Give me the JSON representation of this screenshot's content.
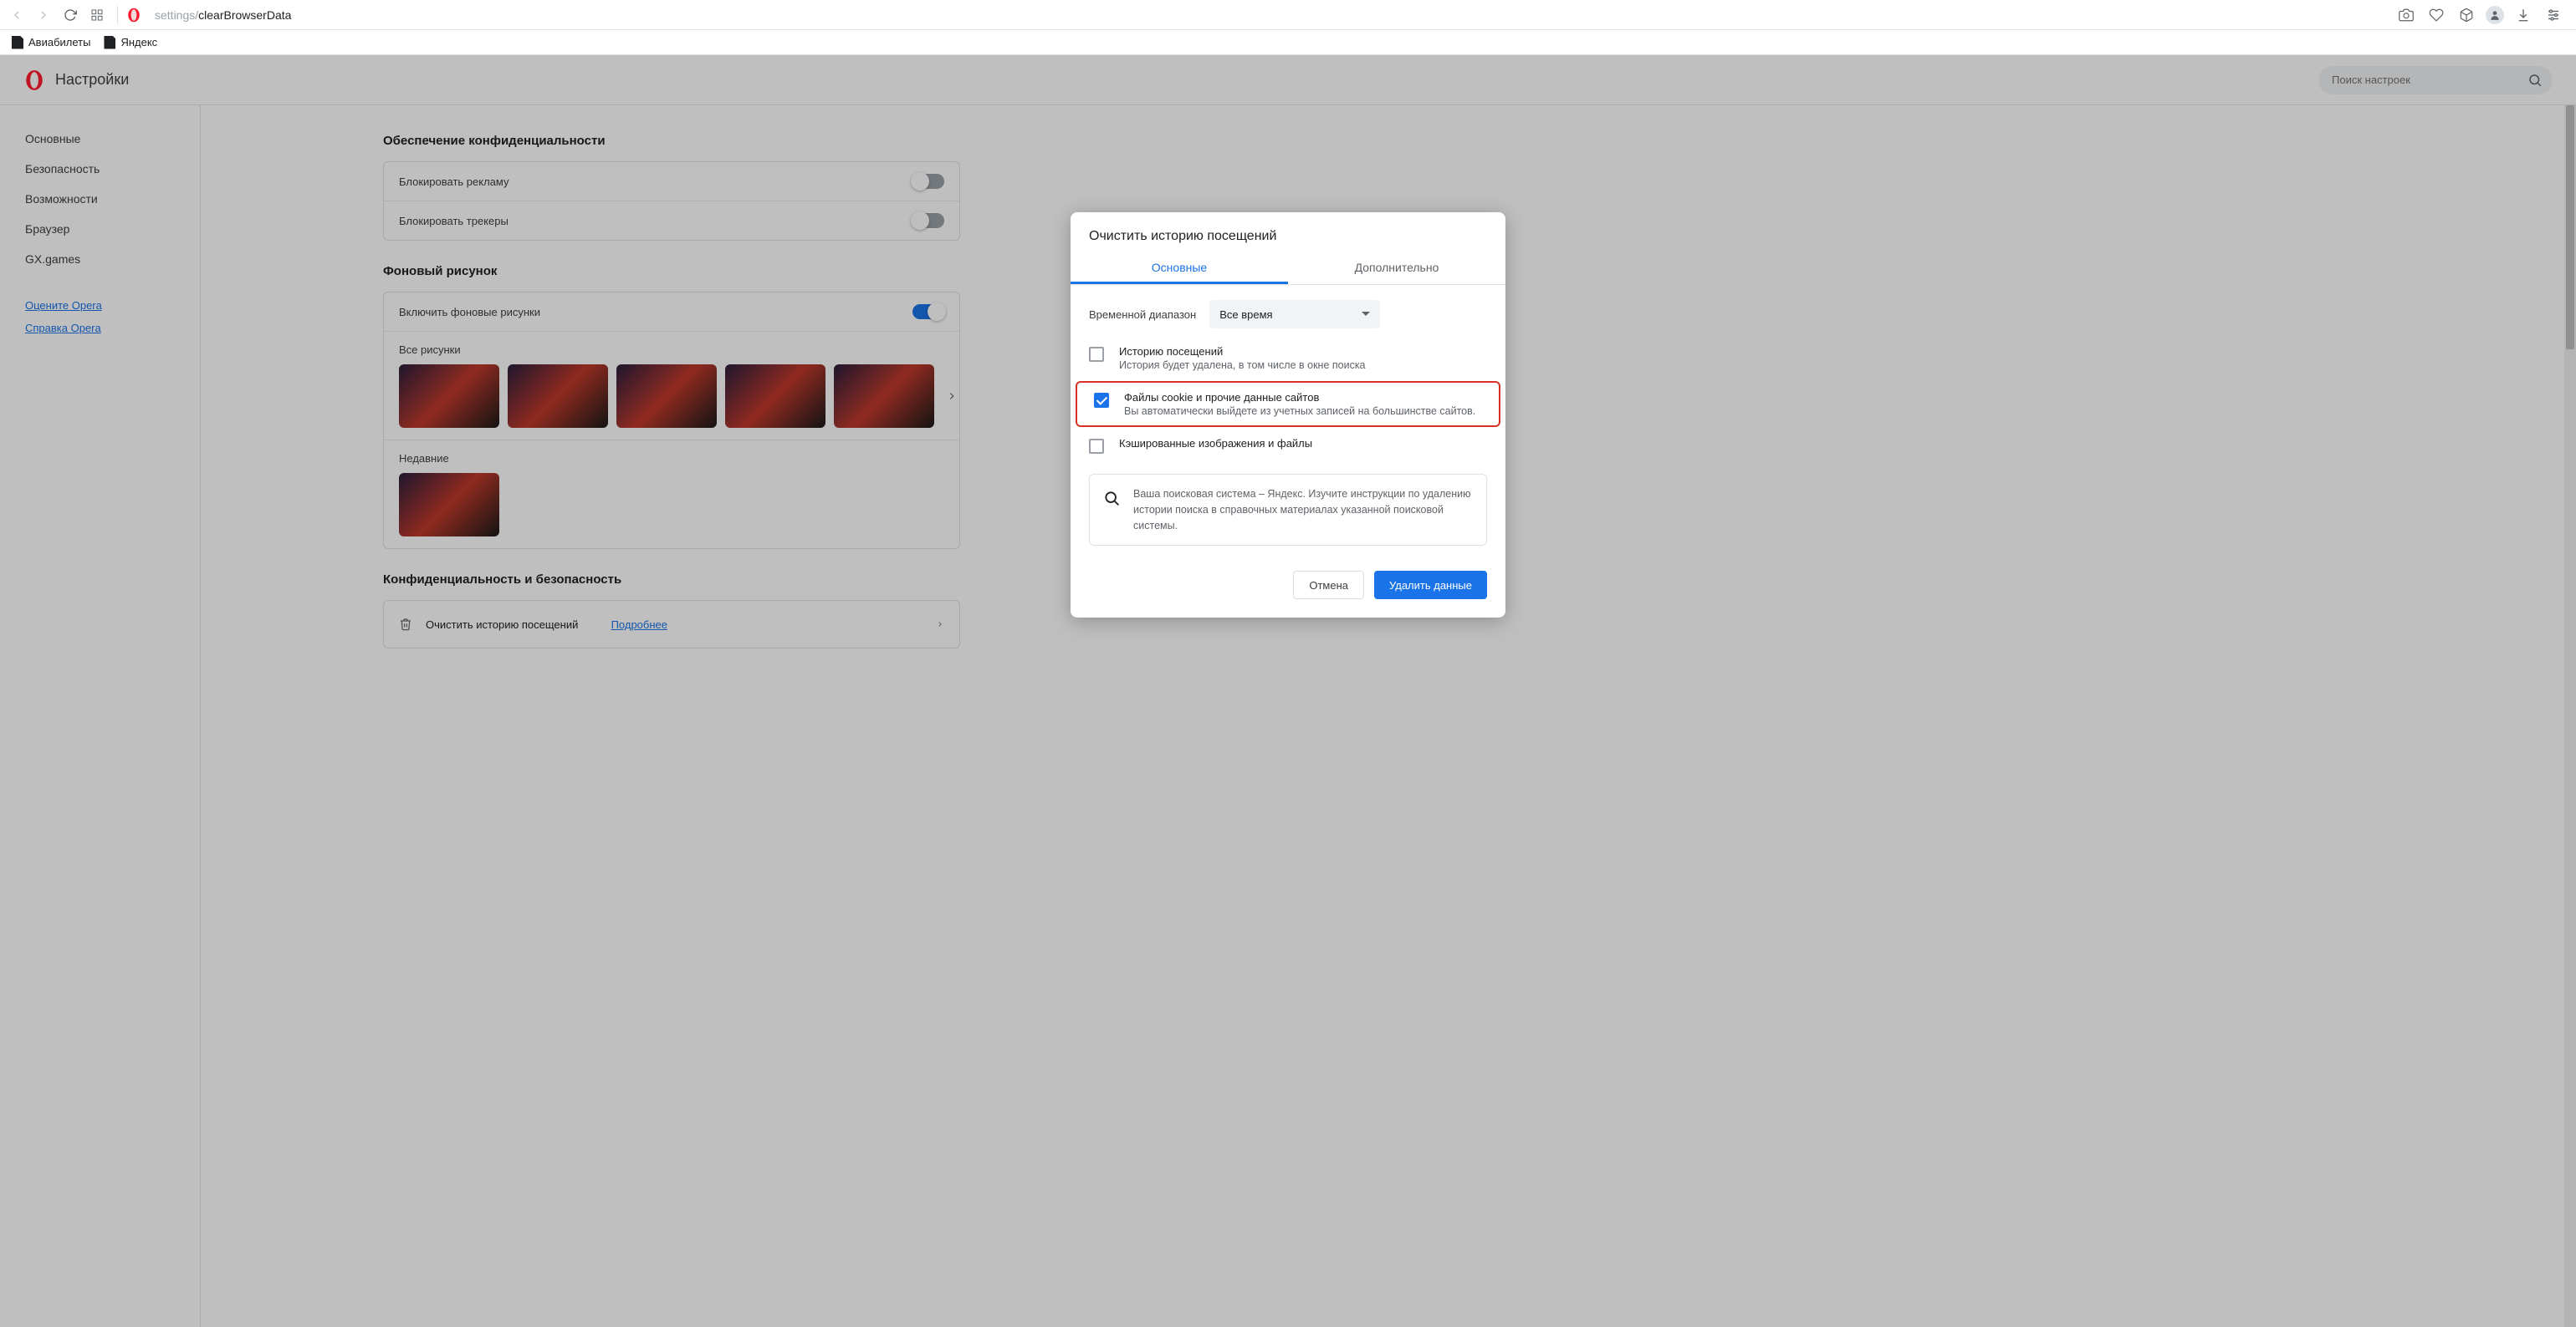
{
  "toolbar": {
    "url_grey": "settings/",
    "url_dark": "clearBrowserData"
  },
  "bookmarks": [
    {
      "label": "Авиабилеты"
    },
    {
      "label": "Яндекс"
    }
  ],
  "header": {
    "title": "Настройки",
    "search_placeholder": "Поиск настроек"
  },
  "sidebar": {
    "items": [
      "Основные",
      "Безопасность",
      "Возможности",
      "Браузер",
      "GX.games"
    ],
    "links": [
      "Оцените Opera",
      "Справка Opera"
    ]
  },
  "sections": {
    "privacy_protection_title": "Обеспечение конфиденциальности",
    "row_block1": "Блокировать рекламу",
    "row_block2": "Блокировать трекеры",
    "wallpaper_title": "Фоновый рисунок",
    "wallpaper_enable": "Включить фоновые рисунки",
    "wallpaper_all": "Все рисунки",
    "wallpaper_recent": "Недавние",
    "privsec_title": "Конфиденциальность и безопасность",
    "clear_label": "Очистить историю посещений",
    "clear_link": "Подробнее"
  },
  "modal": {
    "title": "Очистить историю посещений",
    "tab_basic": "Основные",
    "tab_adv": "Дополнительно",
    "range_label": "Временной диапазон",
    "range_value": "Все время",
    "items": [
      {
        "checked": false,
        "highlight": false,
        "title": "Историю посещений",
        "sub": "История будет удалена, в том числе в окне поиска"
      },
      {
        "checked": true,
        "highlight": true,
        "title": "Файлы cookie и прочие данные сайтов",
        "sub": "Вы автоматически выйдете из учетных записей на большинстве сайтов."
      },
      {
        "checked": false,
        "highlight": false,
        "title": "Кэшированные изображения и файлы",
        "sub": ""
      }
    ],
    "info": "Ваша поисковая система – Яндекс. Изучите инструкции по удалению истории поиска в справочных материалах указанной поисковой системы.",
    "cancel": "Отмена",
    "confirm": "Удалить данные"
  }
}
